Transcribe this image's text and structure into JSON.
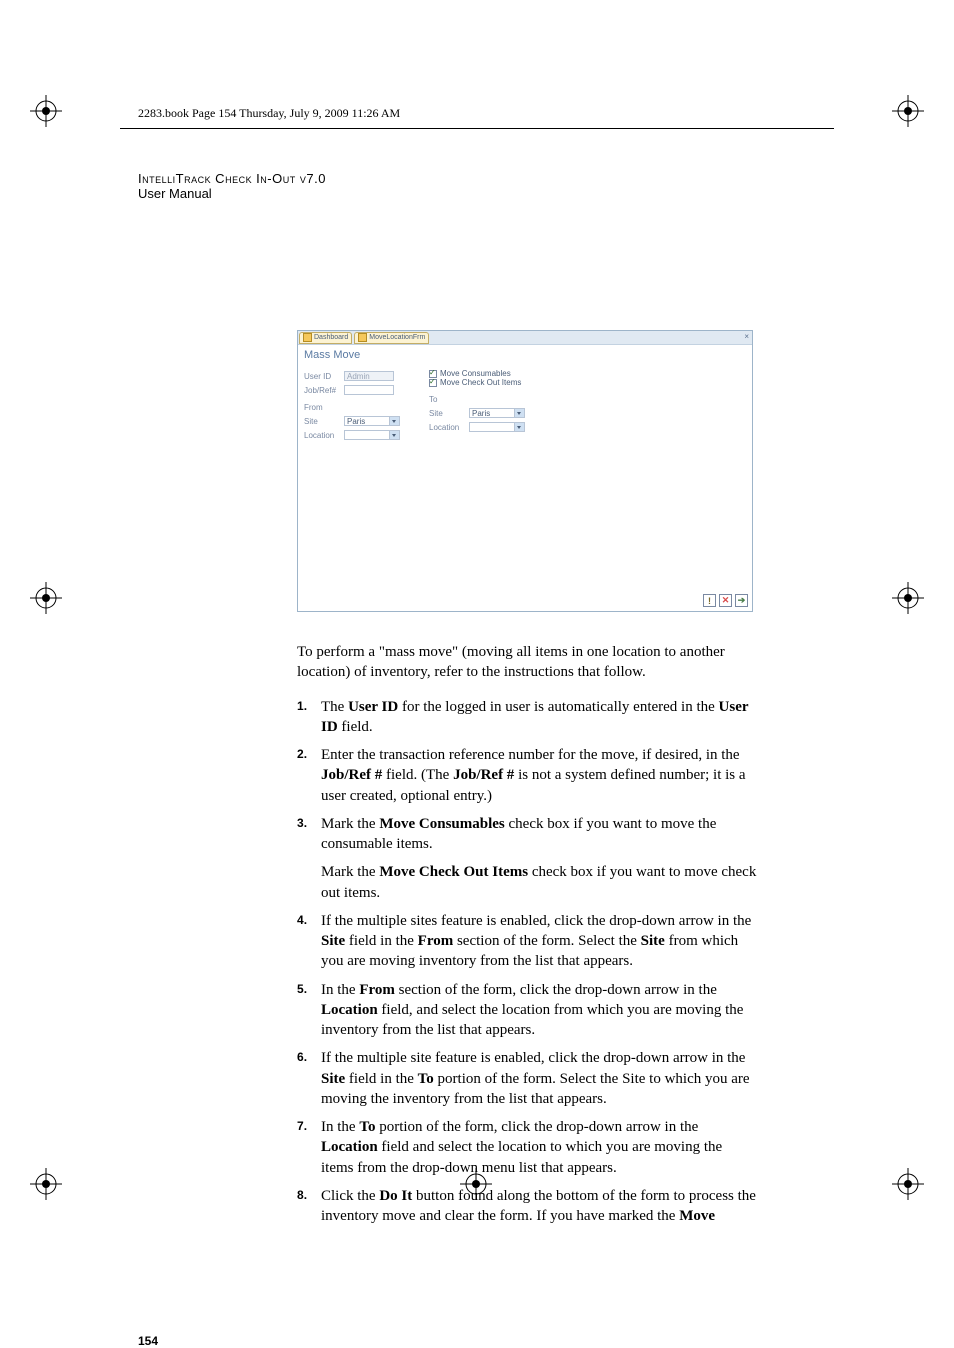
{
  "header_line": "2283.book  Page 154  Thursday, July 9, 2009  11:26 AM",
  "doc_title": "IntelliTrack Check In-Out v7.0",
  "doc_subtitle": "User Manual",
  "page_number": "154",
  "screenshot": {
    "tab1": "Dashboard",
    "tab2": "MoveLocationFrm",
    "title": "Mass Move",
    "user_id_label": "User ID",
    "user_id_value": "Admin",
    "jobref_label": "Job/Ref#",
    "jobref_value": "",
    "checkbox1": "Move Consumables",
    "checkbox2": "Move Check Out Items",
    "from_label": "From",
    "to_label": "To",
    "site_label": "Site",
    "location_label": "Location",
    "from_site_value": "Paris",
    "from_location_value": "",
    "to_site_value": "Paris",
    "to_location_value": ""
  },
  "intro": "To perform a \"mass move\" (moving all items in one location to another location) of inventory, refer to the instructions that follow.",
  "steps": {
    "s1_a": "The ",
    "s1_b": "User ID",
    "s1_c": " for the logged in user is automatically entered in the ",
    "s1_d": "User ID",
    "s1_e": " field.",
    "s2_a": "Enter the transaction reference number for the move, if desired, in the ",
    "s2_b": "Job/Ref #",
    "s2_c": " field. (The ",
    "s2_d": "Job/Ref #",
    "s2_e": " is not a system defined number; it is a user created, optional entry.)",
    "s3_a": "Mark the ",
    "s3_b": "Move Consumables",
    "s3_c": " check box if you want to move the consumable items.",
    "s3_sub_a": "Mark the ",
    "s3_sub_b": "Move Check Out Items",
    "s3_sub_c": " check box if you want to move check out items.",
    "s4_a": "If the multiple sites feature is enabled, click the drop-down arrow in the ",
    "s4_b": "Site",
    "s4_c": " field in the ",
    "s4_d": "From",
    "s4_e": " section of the form. Select the ",
    "s4_f": "Site",
    "s4_g": " from which you are moving inventory from the list that appears.",
    "s5_a": "In the ",
    "s5_b": "From",
    "s5_c": " section of the form, click the drop-down arrow in the ",
    "s5_d": "Location",
    "s5_e": " field, and select the location from which you are moving the inventory from the list that appears.",
    "s6_a": "If the multiple site feature is enabled, click the drop-down arrow in the ",
    "s6_b": "Site",
    "s6_c": " field in the ",
    "s6_d": "To",
    "s6_e": " portion of the form. Select the Site to which you are moving the inventory from the list that appears.",
    "s7_a": "In the ",
    "s7_b": "To",
    "s7_c": " portion of the form, click the drop-down arrow in the ",
    "s7_d": "Location",
    "s7_e": " field and select the location to which you are moving the items from the drop-down menu list that appears.",
    "s8_a": "Click the ",
    "s8_b": "Do It",
    "s8_c": " button found along the bottom of the form to process the inventory move and clear the form. If you have marked the ",
    "s8_d": "Move"
  }
}
